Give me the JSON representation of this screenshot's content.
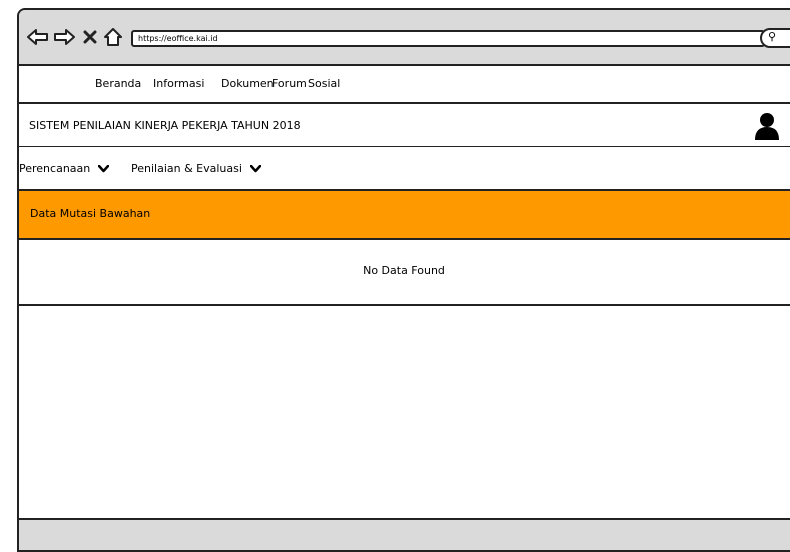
{
  "browser": {
    "url": "https://eoffice.kai.id",
    "back_icon": "arrow-left-icon",
    "forward_icon": "arrow-right-icon",
    "close_icon": "x-icon",
    "home_icon": "home-icon",
    "search_icon": "search-icon"
  },
  "menu": {
    "items": [
      "Beranda",
      "Informasi",
      "Dokumen",
      "Forum",
      "Sosial"
    ]
  },
  "header": {
    "title": "SISTEM PENILAIAN KINERJA PEKERJA TAHUN 2018",
    "avatar_icon": "user-icon"
  },
  "submenu": {
    "items": [
      "Perencanaan",
      "Penilaian & Evaluasi"
    ]
  },
  "section": {
    "title": "Data Mutasi Bawahan",
    "empty_message": "No Data Found",
    "accent_color": "#ff9900"
  }
}
